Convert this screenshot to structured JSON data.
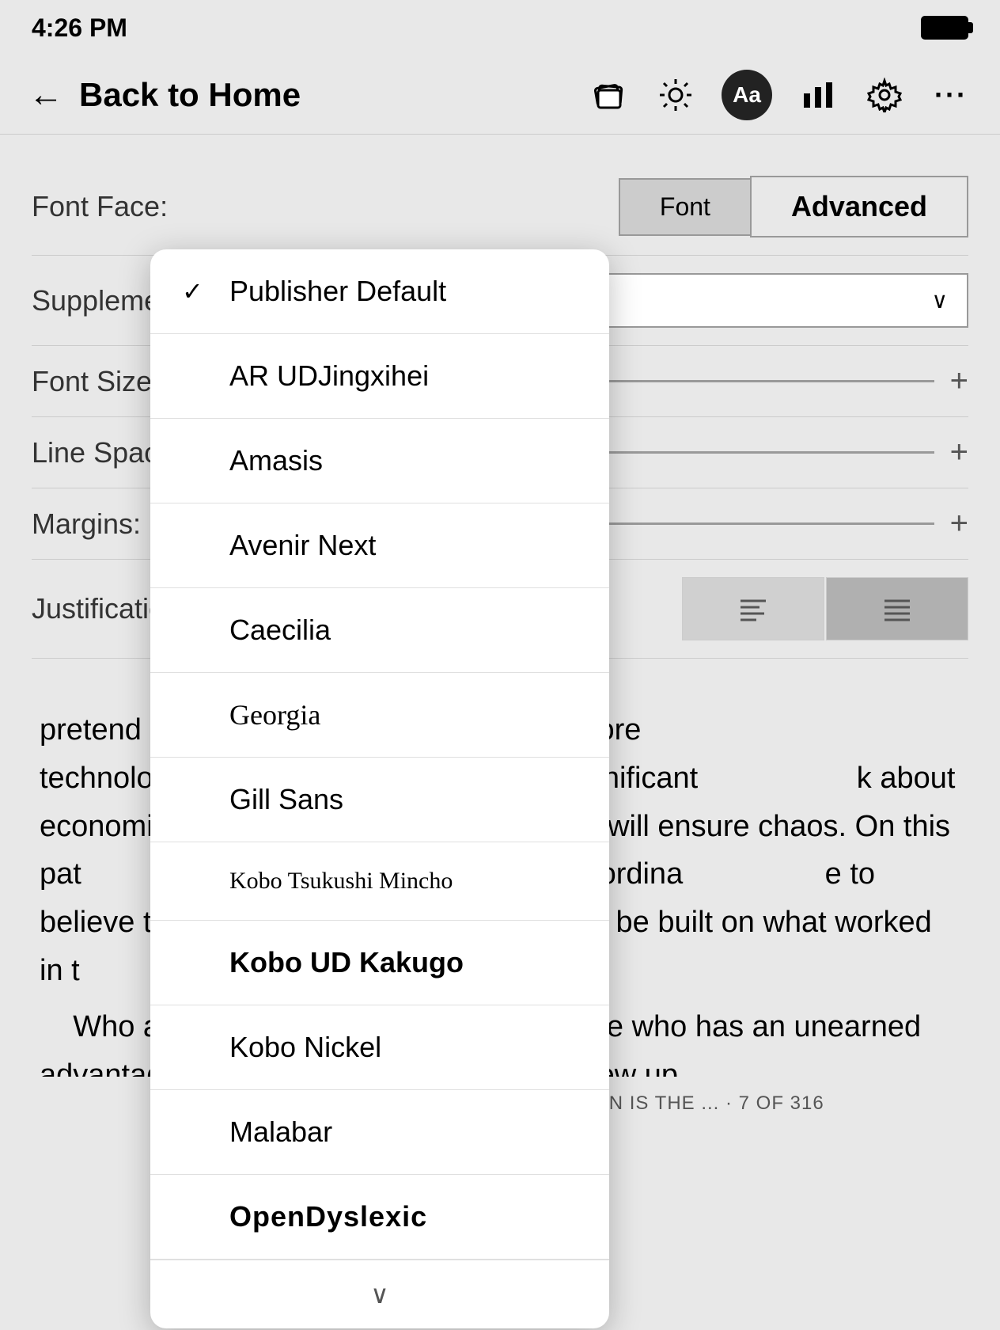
{
  "statusBar": {
    "time": "4:26 PM"
  },
  "navBar": {
    "backLabel": "Back to Home",
    "icons": {
      "cards": "🃏",
      "brightness": "☀",
      "aa": "Aa",
      "chart": "📊",
      "settings": "⚙",
      "more": "•••"
    }
  },
  "settingsPanel": {
    "tabs": [
      {
        "label": "Font",
        "active": false
      },
      {
        "label": "Advanced",
        "active": false
      }
    ],
    "rows": {
      "fontFace": "Font Face:",
      "supplemental": "Supplementa",
      "fontSize": "Font Size:",
      "lineSpacing": "Line Spacing",
      "margins": "Margins:",
      "justification": "Justification:"
    }
  },
  "fontDropdown": {
    "items": [
      {
        "label": "Publisher Default",
        "checked": true
      },
      {
        "label": "AR UDJingxihei",
        "checked": false
      },
      {
        "label": "Amasis",
        "checked": false
      },
      {
        "label": "Avenir Next",
        "checked": false
      },
      {
        "label": "Caecilia",
        "checked": false
      },
      {
        "label": "Georgia",
        "checked": false
      },
      {
        "label": "Gill Sans",
        "checked": false
      },
      {
        "label": "Kobo Tsukushi Mincho",
        "checked": false
      },
      {
        "label": "Kobo UD Kakugo",
        "checked": false
      },
      {
        "label": "Kobo Nickel",
        "checked": false
      },
      {
        "label": "Malabar",
        "checked": false
      },
      {
        "label": "OpenDyslexic",
        "checked": false
      }
    ]
  },
  "bookContent": {
    "paragraphs": [
      "pretend the                         y did in an era before technology                         g path, without significant                          k about economics and the way we                          es will ensure chaos. On this pat                          set to explode. In this extraordina                          e to believe that what will work i                          rily be built on what worked in t",
      "Who am I to be saying this? I'm someone who has an unearned advantage and wants to use it to help. I grew up"
    ],
    "footer": "THE PRICE OF TOMORROW: WHY DEFLATION IS THE ... · 7 OF 316"
  }
}
